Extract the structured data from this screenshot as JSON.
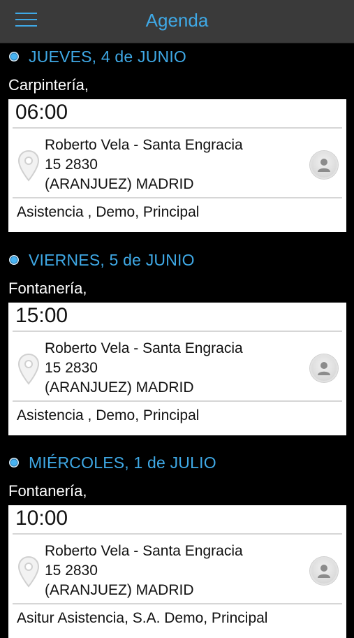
{
  "header": {
    "title": "Agenda"
  },
  "agenda": [
    {
      "date": "JUEVES, 4 de JUNIO",
      "service": "Carpintería,",
      "time": "06:00",
      "address_line1": "Roberto Vela - Santa Engracia",
      "address_line2": "15   2830",
      "address_line3": "(ARANJUEZ) MADRID",
      "tags": "Asistencia  , Demo, Principal"
    },
    {
      "date": "VIERNES, 5 de JUNIO",
      "service": "Fontanería,",
      "time": "15:00",
      "address_line1": "Roberto Vela - Santa Engracia",
      "address_line2": "15   2830",
      "address_line3": "(ARANJUEZ) MADRID",
      "tags": "Asistencia  , Demo, Principal"
    },
    {
      "date": "MIÉRCOLES, 1 de JULIO",
      "service": "Fontanería,",
      "time": "10:00",
      "address_line1": "Roberto Vela - Santa Engracia",
      "address_line2": "15   2830",
      "address_line3": "(ARANJUEZ) MADRID",
      "tags": "Asitur Asistencia, S.A. Demo, Principal"
    }
  ],
  "colors": {
    "accent": "#3fa9e6",
    "topbar": "#3a3a3a",
    "background": "#000000",
    "card": "#ffffff"
  },
  "icons": {
    "menu": "hamburger-menu-icon",
    "location": "map-pin-icon",
    "contact": "person-icon",
    "day_bullet": "bullet-dot-icon"
  }
}
